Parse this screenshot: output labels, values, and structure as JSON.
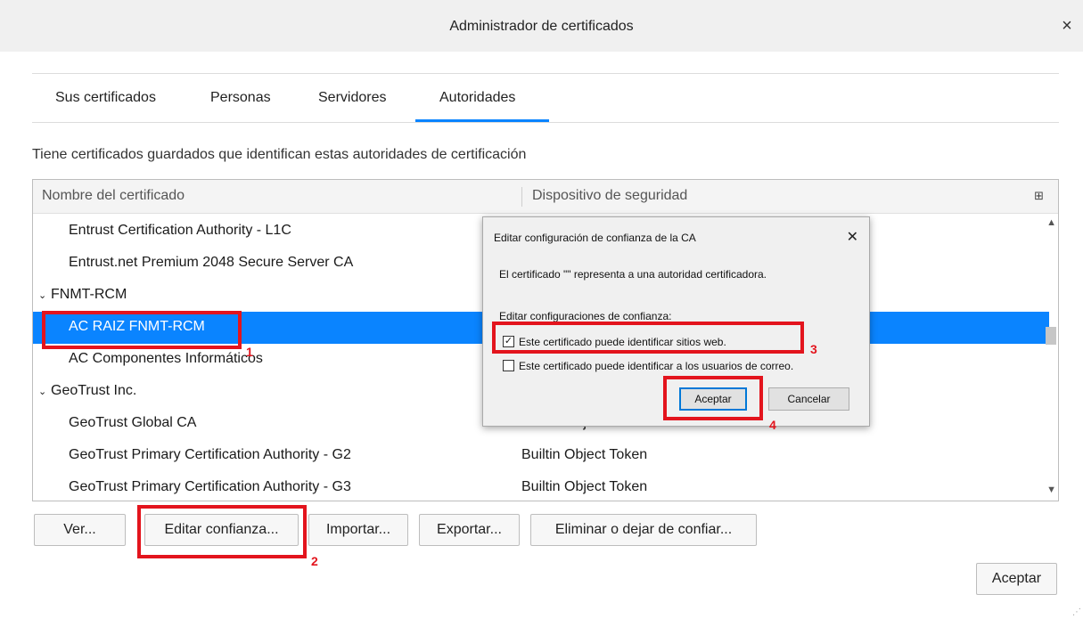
{
  "window": {
    "title": "Administrador de certificados",
    "close": "×"
  },
  "tabs": [
    {
      "label": "Sus certificados"
    },
    {
      "label": "Personas"
    },
    {
      "label": "Servidores"
    },
    {
      "label": "Autoridades",
      "active": true
    }
  ],
  "description": "Tiene certificados guardados que identifican estas autoridades de certificación",
  "table": {
    "columns": [
      "Nombre del certificado",
      "Dispositivo de seguridad"
    ],
    "column_picker_icon": "⊞",
    "rows": [
      {
        "name": "Entrust Certification Authority - L1C",
        "device": ""
      },
      {
        "name": "Entrust.net Premium 2048 Secure Server CA",
        "device": ""
      },
      {
        "name": "FNMT-RCM",
        "device": "",
        "group": true,
        "caret": "⌄"
      },
      {
        "name": "AC RAIZ FNMT-RCM",
        "device": "",
        "selected": true
      },
      {
        "name": "AC Componentes Informáticos",
        "device": ""
      },
      {
        "name": "GeoTrust Inc.",
        "device": "",
        "group": true,
        "caret": "⌄"
      },
      {
        "name": "GeoTrust Global CA",
        "device": "Builtin Object Token"
      },
      {
        "name": "GeoTrust Primary Certification Authority - G2",
        "device": "Builtin Object Token"
      },
      {
        "name": "GeoTrust Primary Certification Authority - G3",
        "device": "Builtin Object Token"
      }
    ]
  },
  "buttons": {
    "ver": "Ver...",
    "editar": "Editar confianza...",
    "importar": "Importar...",
    "exportar": "Exportar...",
    "eliminar": "Eliminar o dejar de confiar...",
    "aceptar": "Aceptar"
  },
  "dialog": {
    "title": "Editar configuración de confianza de la CA",
    "close": "✕",
    "message": "El certificado \"\" representa a una autoridad certificadora.",
    "subtitle": "Editar configuraciones de confianza:",
    "checkboxes": [
      {
        "label": "Este certificado puede identificar sitios web.",
        "checked": true,
        "mark": "✓"
      },
      {
        "label": "Este certificado puede identificar a los usuarios de correo.",
        "checked": false,
        "mark": ""
      }
    ],
    "ok": "Aceptar",
    "cancel": "Cancelar"
  },
  "annotations": {
    "m1": "1",
    "m2": "2",
    "m3": "3",
    "m4": "4",
    "color": "#e3141d"
  },
  "colors": {
    "selection": "#0a84ff",
    "accent": "#0a84ff"
  }
}
